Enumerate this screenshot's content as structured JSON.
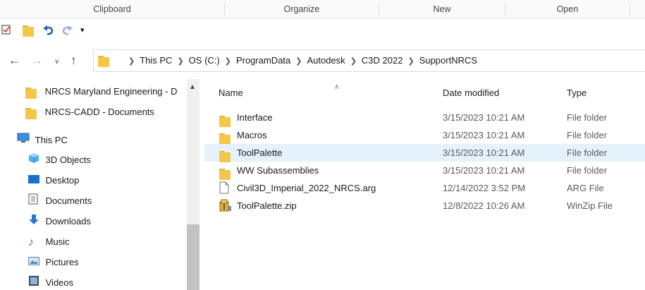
{
  "ribbon": {
    "groups": [
      "Clipboard",
      "Organize",
      "New",
      "Open"
    ]
  },
  "qat": {
    "icons": [
      "properties-check-icon",
      "new-folder-icon",
      "undo-icon",
      "redo-icon",
      "customize-dropdown-icon"
    ]
  },
  "address": {
    "crumbs": [
      "This PC",
      "OS (C:)",
      "ProgramData",
      "Autodesk",
      "C3D 2022",
      "SupportNRCS"
    ]
  },
  "navpane": {
    "items": [
      {
        "label": "NRCS Maryland Engineering - D",
        "icon": "folder-icon"
      },
      {
        "label": "NRCS-CADD - Documents",
        "icon": "folder-icon"
      },
      {
        "label": "This PC",
        "icon": "computer-icon"
      },
      {
        "label": "3D Objects",
        "icon": "3d-objects-icon"
      },
      {
        "label": "Desktop",
        "icon": "desktop-icon"
      },
      {
        "label": "Documents",
        "icon": "documents-icon"
      },
      {
        "label": "Downloads",
        "icon": "downloads-icon"
      },
      {
        "label": "Music",
        "icon": "music-icon"
      },
      {
        "label": "Pictures",
        "icon": "pictures-icon"
      },
      {
        "label": "Videos",
        "icon": "videos-icon"
      }
    ]
  },
  "files": {
    "headers": {
      "name": "Name",
      "date": "Date modified",
      "type": "Type"
    },
    "rows": [
      {
        "name": "Interface",
        "date": "3/15/2023 10:21 AM",
        "type": "File folder",
        "icon": "folder-icon"
      },
      {
        "name": "Macros",
        "date": "3/15/2023 10:21 AM",
        "type": "File folder",
        "icon": "folder-icon"
      },
      {
        "name": "ToolPalette",
        "date": "3/15/2023 10:21 AM",
        "type": "File folder",
        "icon": "folder-icon",
        "selected": true
      },
      {
        "name": "WW Subassemblies",
        "date": "3/15/2023 10:21 AM",
        "type": "File folder",
        "icon": "folder-icon"
      },
      {
        "name": "Civil3D_Imperial_2022_NRCS.arg",
        "date": "12/14/2022 3:52 PM",
        "type": "ARG File",
        "icon": "file-icon"
      },
      {
        "name": "ToolPalette.zip",
        "date": "12/8/2022 10:26 AM",
        "type": "WinZip File",
        "icon": "zip-icon"
      }
    ]
  },
  "colors": {
    "selection": "#e5f1fb",
    "folder": "#f5c748",
    "accent": "#0078d7"
  }
}
